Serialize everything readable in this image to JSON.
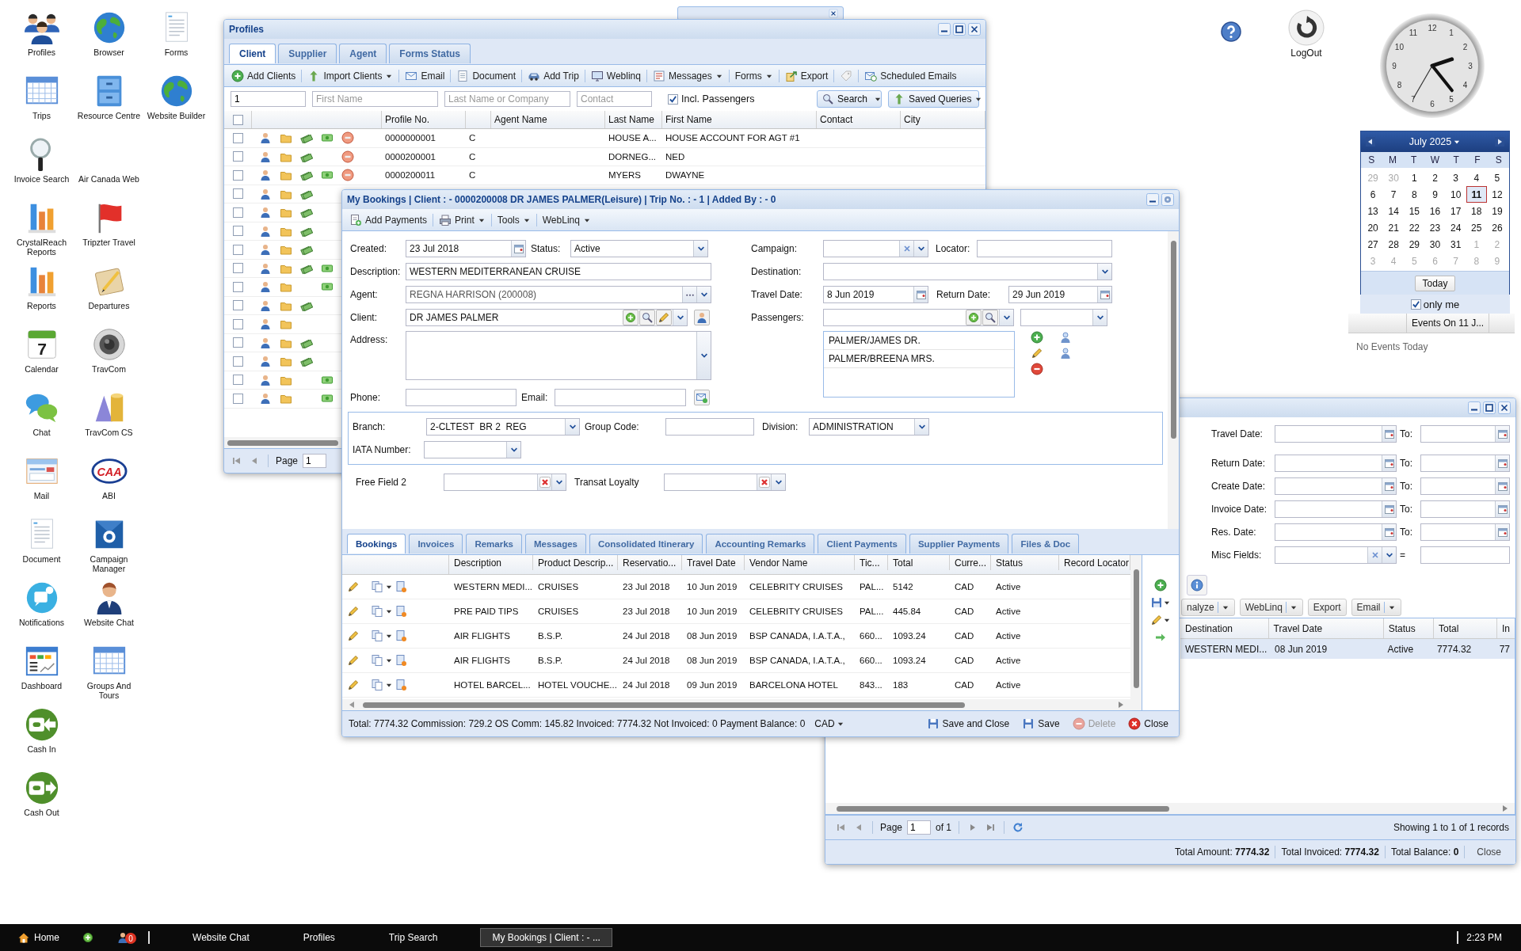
{
  "desktop_columns": [
    [
      {
        "label": "Profiles",
        "kind": "people"
      },
      {
        "label": "Trips",
        "kind": "table"
      },
      {
        "label": "Invoice Search",
        "kind": "magnifier"
      },
      {
        "label": "CrystalReach Reports",
        "kind": "bars"
      },
      {
        "label": "Reports",
        "kind": "bars"
      },
      {
        "label": "Calendar",
        "kind": "calendar",
        "icon_text": "7"
      },
      {
        "label": "Chat",
        "kind": "chat"
      },
      {
        "label": "Mail",
        "kind": "mail"
      },
      {
        "label": "Document",
        "kind": "document"
      },
      {
        "label": "Notifications",
        "kind": "bell"
      },
      {
        "label": "Dashboard",
        "kind": "dashboard"
      },
      {
        "label": "Cash In",
        "kind": "cash-in"
      },
      {
        "label": "Cash Out",
        "kind": "cash-out"
      }
    ],
    [
      {
        "label": "Browser",
        "kind": "globe"
      },
      {
        "label": "Resource Centre",
        "kind": "cabinet"
      },
      {
        "label": "Air Canada Web",
        "kind": "none"
      },
      {
        "label": "Tripzter Travel",
        "kind": "flag"
      },
      {
        "label": "Departures",
        "kind": "notepad"
      },
      {
        "label": "TravCom",
        "kind": "speaker"
      },
      {
        "label": "TravCom CS",
        "kind": "shapes"
      },
      {
        "label": "ABI",
        "kind": "oval-logo",
        "icon_text": "CAA"
      },
      {
        "label": "Campaign Manager",
        "kind": "envelope"
      },
      {
        "label": "Website Chat",
        "kind": "agent"
      },
      {
        "label": "Groups And Tours",
        "kind": "table"
      }
    ],
    [
      {
        "label": "Forms",
        "kind": "document"
      },
      {
        "label": "Website Builder",
        "kind": "globe"
      }
    ]
  ],
  "profiles_window": {
    "title": "Profiles",
    "tabs": [
      {
        "label": "Client",
        "selected": true
      },
      {
        "label": "Supplier",
        "selected": false
      },
      {
        "label": "Agent",
        "selected": false
      },
      {
        "label": "Forms Status",
        "selected": false
      }
    ],
    "toolbar": [
      {
        "label": "Add Clients",
        "kind": "add",
        "menu": false
      },
      {
        "label": "Import Clients",
        "kind": "import",
        "menu": true
      },
      {
        "label": "Email",
        "kind": "mail",
        "menu": false
      },
      {
        "label": "Document",
        "kind": "doc",
        "menu": false
      },
      {
        "label": "Add Trip",
        "kind": "car",
        "menu": false
      },
      {
        "label": "Weblinq",
        "kind": "monitor",
        "menu": false
      },
      {
        "label": "Messages",
        "kind": "messages",
        "menu": true
      },
      {
        "label": "Forms",
        "kind": "plain",
        "menu": true
      },
      {
        "label": "Export",
        "kind": "export",
        "menu": false
      },
      {
        "kind": "tag",
        "menu": false
      },
      {
        "label": "Scheduled Emails",
        "kind": "schedule",
        "menu": false
      }
    ],
    "search_fields": [
      {
        "value": "1"
      },
      {
        "placeholder": "First Name"
      },
      {
        "placeholder": "Last Name or Company"
      },
      {
        "placeholder": "Contact"
      }
    ],
    "include_passengers": {
      "label": "Incl. Passengers",
      "checked": true
    },
    "search_button": "Search",
    "saved_queries": "Saved Queries",
    "select_all": {
      "checked": false
    },
    "columns": [
      "Profile No.",
      "Agent Name",
      "Last Name",
      "First Name",
      "Contact",
      "City"
    ],
    "rows": [
      {
        "checked": false,
        "money": true,
        "dollar": true,
        "blocked": true,
        "profile_no": "0000000001",
        "type": "C",
        "last_name": "HOUSE A...",
        "first_name": "HOUSE ACCOUNT FOR AGT #1"
      },
      {
        "checked": false,
        "money": true,
        "dollar": false,
        "blocked": true,
        "profile_no": "0000200001",
        "type": "C",
        "last_name": "DORNEG...",
        "first_name": "NED"
      },
      {
        "checked": false,
        "money": true,
        "dollar": true,
        "blocked": true,
        "profile_no": "0000200011",
        "type": "C",
        "last_name": "MYERS",
        "first_name": "DWAYNE"
      },
      {
        "checked": false,
        "money": true,
        "dollar": false
      },
      {
        "checked": false,
        "money": true,
        "dollar": false
      },
      {
        "checked": false,
        "money": true,
        "dollar": false
      },
      {
        "checked": false,
        "money": true,
        "dollar": false
      },
      {
        "checked": false,
        "money": true,
        "dollar": true
      },
      {
        "checked": false,
        "money": false,
        "dollar": true
      },
      {
        "checked": false,
        "money": true,
        "dollar": false
      },
      {
        "checked": false,
        "money": false,
        "dollar": false
      },
      {
        "checked": false,
        "money": true,
        "dollar": false
      },
      {
        "checked": false,
        "money": true,
        "dollar": false
      },
      {
        "checked": false,
        "money": false,
        "dollar": true
      },
      {
        "checked": false,
        "money": false,
        "dollar": true
      }
    ],
    "paging": {
      "label": "Page",
      "page": "1"
    }
  },
  "bookings_window": {
    "title": "My Bookings | Client : - 0000200008 DR JAMES PALMER(Leisure) | Trip No. : - 1 | Added By : - 0",
    "toolbar": [
      {
        "label": "Add Payments",
        "kind": "payment",
        "menu": false
      },
      {
        "label": "Print",
        "kind": "printer",
        "menu": true
      },
      {
        "label": "Tools",
        "kind": "plain",
        "menu": true
      },
      {
        "label": "WebLinq",
        "kind": "plain",
        "menu": true
      }
    ],
    "form": {
      "created": {
        "label": "Created:",
        "value": "23 Jul 2018"
      },
      "status": {
        "label": "Status:",
        "value": "Active"
      },
      "description": {
        "label": "Description:",
        "value": "WESTERN MEDITERRANEAN CRUISE"
      },
      "agent": {
        "label": "Agent:",
        "value": "REGNA HARRISON (200008)"
      },
      "client": {
        "label": "Client:",
        "value": "DR JAMES PALMER"
      },
      "address": {
        "label": "Address:"
      },
      "phone": {
        "label": "Phone:"
      },
      "email": {
        "label": "Email:"
      },
      "campaign": {
        "label": "Campaign:"
      },
      "locator": {
        "label": "Locator:"
      },
      "destination": {
        "label": "Destination:"
      },
      "travel_date": {
        "label": "Travel Date:",
        "value": "8 Jun 2019"
      },
      "return_date": {
        "label": "Return Date:",
        "value": "29 Jun 2019"
      },
      "passengers": {
        "label": "Passengers:",
        "list": [
          "PALMER/JAMES DR.",
          "PALMER/BREENA MRS."
        ]
      },
      "branch": {
        "label": "Branch:",
        "value": "2-CLTEST  BR 2  REG"
      },
      "group_code": {
        "label": "Group Code:"
      },
      "division": {
        "label": "Division:",
        "value": "ADMINISTRATION"
      },
      "iata": {
        "label": "IATA Number:"
      },
      "free_field_2": {
        "label": "Free Field 2"
      },
      "transat_loyalty": {
        "label": "Transat Loyalty"
      }
    },
    "tabs": [
      {
        "label": "Bookings",
        "selected": true
      },
      {
        "label": "Invoices",
        "selected": false
      },
      {
        "label": "Remarks",
        "selected": false
      },
      {
        "label": "Messages",
        "selected": false
      },
      {
        "label": "Consolidated Itinerary",
        "selected": false
      },
      {
        "label": "Accounting Remarks",
        "selected": false
      },
      {
        "label": "Client Payments",
        "selected": false
      },
      {
        "label": "Supplier Payments",
        "selected": false
      },
      {
        "label": "Files & Doc",
        "selected": false
      }
    ],
    "columns": [
      "Description",
      "Product Descrip...",
      "Reservatio...",
      "Travel Date",
      "Vendor Name",
      "Tic...",
      "Total",
      "Curre...",
      "Status",
      "Record Locator"
    ],
    "rows": [
      {
        "description": "WESTERN MEDI...",
        "product": "CRUISES",
        "reservation": "23 Jul 2018",
        "travel_date": "10 Jun 2019",
        "vendor": "CELEBRITY CRUISES",
        "ticket": "PAL...",
        "total": "5142",
        "currency": "CAD",
        "status": "Active"
      },
      {
        "description": "PRE PAID TIPS",
        "product": "CRUISES",
        "reservation": "23 Jul 2018",
        "travel_date": "10 Jun 2019",
        "vendor": "CELEBRITY CRUISES",
        "ticket": "PAL...",
        "total": "445.84",
        "currency": "CAD",
        "status": "Active"
      },
      {
        "description": "AIR FLIGHTS",
        "product": "B.S.P.",
        "reservation": "24 Jul 2018",
        "travel_date": "08 Jun 2019",
        "vendor": "BSP CANADA, I.A.T.A.,",
        "ticket": "660...",
        "total": "1093.24",
        "currency": "CAD",
        "status": "Active"
      },
      {
        "description": "AIR FLIGHTS",
        "product": "B.S.P.",
        "reservation": "24 Jul 2018",
        "travel_date": "08 Jun 2019",
        "vendor": "BSP CANADA, I.A.T.A.,",
        "ticket": "660...",
        "total": "1093.24",
        "currency": "CAD",
        "status": "Active"
      },
      {
        "description": "HOTEL BARCEL...",
        "product": "HOTEL VOUCHE...",
        "reservation": "24 Jul 2018",
        "travel_date": "09 Jun 2019",
        "vendor": "BARCELONA HOTEL",
        "ticket": "843...",
        "total": "183",
        "currency": "CAD",
        "status": "Active"
      }
    ],
    "summary": "Total: 7774.32 Commission: 729.2 OS Comm: 145.82 Invoiced: 7774.32 Not Invoiced: 0 Payment Balance: 0",
    "currency": "CAD",
    "buttons": [
      {
        "label": "Save and Close",
        "kind": "save",
        "disabled": false
      },
      {
        "label": "Save",
        "kind": "save",
        "disabled": false
      },
      {
        "label": "Delete",
        "kind": "delete",
        "disabled": true
      },
      {
        "label": "Close",
        "kind": "close",
        "disabled": false
      }
    ]
  },
  "search_window": {
    "date_rows": [
      {
        "label": "Travel Date:",
        "to": "To:"
      },
      {
        "label": "Return Date:",
        "to": "To:"
      },
      {
        "label": "Create Date:",
        "to": "To:"
      },
      {
        "label": "Invoice Date:",
        "to": "To:"
      },
      {
        "label": "Res. Date:",
        "to": "To:"
      }
    ],
    "misc": {
      "label": "Misc Fields:",
      "equals": "="
    },
    "toolbar": [
      {
        "label": "nalyze",
        "menu": true
      },
      {
        "label": "WebLinq",
        "menu": true
      },
      {
        "label": "Export",
        "menu": false
      },
      {
        "label": "Email",
        "menu": true
      }
    ],
    "columns": [
      "Destination",
      "Travel Date",
      "Status",
      "Total",
      "In"
    ],
    "rows": [
      {
        "cells": [
          "WESTERN MEDI...",
          "08 Jun 2019",
          "Active",
          "7774.32",
          "77"
        ],
        "selected": true
      }
    ],
    "paging": {
      "label": "Page",
      "page": "1",
      "of": "of 1",
      "showing": "Showing 1 to 1 of 1 records"
    },
    "totals": [
      "Total Amount: **7774.32**",
      "Total Invoiced: **7774.32**",
      "Total Balance: **0**"
    ],
    "close": "Close"
  },
  "logout": "LogOut",
  "clock": {
    "numerals": [
      "12",
      "1",
      "2",
      "3",
      "4",
      "5",
      "6",
      "7",
      "8",
      "9",
      "10",
      "11"
    ]
  },
  "calendar": {
    "month": "July 2025",
    "weekdays": [
      "S",
      "M",
      "T",
      "W",
      "T",
      "F",
      "S"
    ],
    "days": [
      {
        "d": "29",
        "other_month": true,
        "selected": false
      },
      {
        "d": "30",
        "other_month": true,
        "selected": false
      },
      {
        "d": "1",
        "other_month": false,
        "selected": false
      },
      {
        "d": "2",
        "other_month": false,
        "selected": false
      },
      {
        "d": "3",
        "other_month": false,
        "selected": false
      },
      {
        "d": "4",
        "other_month": false,
        "selected": false
      },
      {
        "d": "5",
        "other_month": false,
        "selected": false
      },
      {
        "d": "6",
        "other_month": false,
        "selected": false
      },
      {
        "d": "7",
        "other_month": false,
        "selected": false
      },
      {
        "d": "8",
        "other_month": false,
        "selected": false
      },
      {
        "d": "9",
        "other_month": false,
        "selected": false
      },
      {
        "d": "10",
        "other_month": false,
        "selected": false
      },
      {
        "d": "11",
        "other_month": false,
        "selected": true
      },
      {
        "d": "12",
        "other_month": false,
        "selected": false
      },
      {
        "d": "13",
        "other_month": false,
        "selected": false
      },
      {
        "d": "14",
        "other_month": false,
        "selected": false
      },
      {
        "d": "15",
        "other_month": false,
        "selected": false
      },
      {
        "d": "16",
        "other_month": false,
        "selected": false
      },
      {
        "d": "17",
        "other_month": false,
        "selected": false
      },
      {
        "d": "18",
        "other_month": false,
        "selected": false
      },
      {
        "d": "19",
        "other_month": false,
        "selected": false
      },
      {
        "d": "20",
        "other_month": false,
        "selected": false
      },
      {
        "d": "21",
        "other_month": false,
        "selected": false
      },
      {
        "d": "22",
        "other_month": false,
        "selected": false
      },
      {
        "d": "23",
        "other_month": false,
        "selected": false
      },
      {
        "d": "24",
        "other_month": false,
        "selected": false
      },
      {
        "d": "25",
        "other_month": false,
        "selected": false
      },
      {
        "d": "26",
        "other_month": false,
        "selected": false
      },
      {
        "d": "27",
        "other_month": false,
        "selected": false
      },
      {
        "d": "28",
        "other_month": false,
        "selected": false
      },
      {
        "d": "29",
        "other_month": false,
        "selected": false
      },
      {
        "d": "30",
        "other_month": false,
        "selected": false
      },
      {
        "d": "31",
        "other_month": false,
        "selected": false
      },
      {
        "d": "1",
        "other_month": true,
        "selected": false
      },
      {
        "d": "2",
        "other_month": true,
        "selected": false
      },
      {
        "d": "3",
        "other_month": true,
        "selected": false
      },
      {
        "d": "4",
        "other_month": true,
        "selected": false
      },
      {
        "d": "5",
        "other_month": true,
        "selected": false
      },
      {
        "d": "6",
        "other_month": true,
        "selected": false
      },
      {
        "d": "7",
        "other_month": true,
        "selected": false
      },
      {
        "d": "8",
        "other_month": true,
        "selected": false
      },
      {
        "d": "9",
        "other_month": true,
        "selected": false
      }
    ],
    "today": "Today",
    "only_me": {
      "label": "only me",
      "checked": true
    },
    "events_tab": "Events On 11 J...",
    "no_events": "No Events Today"
  },
  "taskbar": {
    "home": "Home",
    "badge": "0",
    "items": [
      {
        "label": "Website Chat",
        "selected": false
      },
      {
        "label": "Profiles",
        "selected": false
      },
      {
        "label": "Trip Search",
        "selected": false
      },
      {
        "label": "My Bookings | Client : - ...",
        "selected": true
      }
    ],
    "time": "2:23 PM"
  }
}
